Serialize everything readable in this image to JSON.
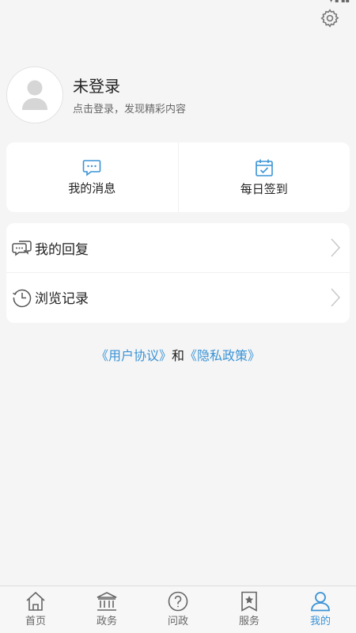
{
  "header": {
    "settings_icon": "gear-icon"
  },
  "profile": {
    "name": "未登录",
    "subtitle": "点击登录，发现精彩内容",
    "avatar_icon": "user-avatar-icon"
  },
  "quick_actions": [
    {
      "label": "我的消息",
      "icon": "message-bubble-icon"
    },
    {
      "label": "每日签到",
      "icon": "calendar-check-icon"
    }
  ],
  "menu": [
    {
      "label": "我的回复",
      "icon": "reply-bubble-icon"
    },
    {
      "label": "浏览记录",
      "icon": "history-clock-icon"
    }
  ],
  "agreement": {
    "user_agreement": "《用户协议》",
    "and": "和",
    "privacy_policy": "《隐私政策》"
  },
  "tabs": [
    {
      "label": "首页",
      "icon": "home-icon",
      "active": false
    },
    {
      "label": "政务",
      "icon": "government-building-icon",
      "active": false
    },
    {
      "label": "问政",
      "icon": "question-circle-icon",
      "active": false
    },
    {
      "label": "服务",
      "icon": "star-bookmark-icon",
      "active": false
    },
    {
      "label": "我的",
      "icon": "profile-icon",
      "active": true
    }
  ],
  "colors": {
    "accent": "#3a93d6",
    "background": "#f5f5f5",
    "card": "#ffffff"
  }
}
